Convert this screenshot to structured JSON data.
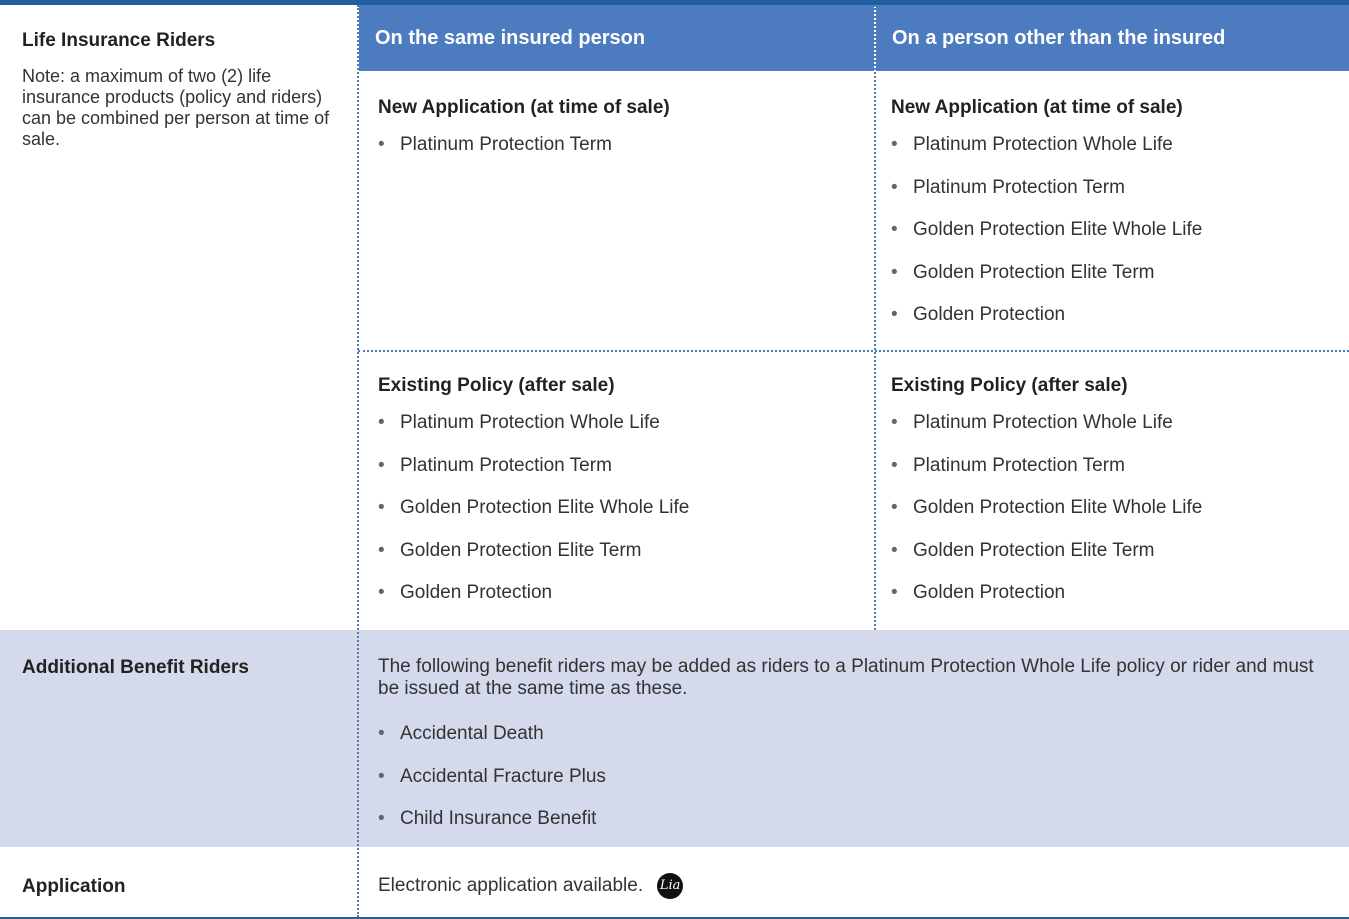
{
  "header": {
    "col_same": "On the same insured person",
    "col_other": "On a person other than the insured"
  },
  "life_riders": {
    "title": "Life Insurance Riders",
    "note": "Note: a maximum of two (2) life insurance products (policy and riders) can be combined per person at time of sale."
  },
  "same_new": {
    "heading": "New Application (at time of sale)",
    "items": [
      "Platinum Protection Term"
    ]
  },
  "other_new": {
    "heading": "New Application (at time of sale)",
    "items": [
      "Platinum Protection Whole Life",
      "Platinum Protection Term",
      "Golden Protection Elite Whole Life",
      "Golden Protection Elite Term",
      "Golden Protection"
    ]
  },
  "same_existing": {
    "heading": "Existing Policy (after sale)",
    "items": [
      "Platinum Protection Whole Life",
      "Platinum Protection Term",
      "Golden Protection Elite Whole Life",
      "Golden Protection Elite Term",
      "Golden Protection"
    ]
  },
  "other_existing": {
    "heading": "Existing Policy (after sale)",
    "items": [
      "Platinum Protection Whole Life",
      "Platinum Protection Term",
      "Golden Protection Elite Whole Life",
      "Golden Protection Elite Term",
      "Golden Protection"
    ]
  },
  "additional": {
    "title": "Additional Benefit Riders",
    "description": "The following benefit riders may be added as riders to a Platinum Protection Whole Life policy or rider and must be issued at the same time as these.",
    "items": [
      "Accidental Death",
      "Accidental Fracture Plus",
      "Child Insurance Benefit"
    ]
  },
  "application": {
    "title": "Application",
    "text": "Electronic application available.",
    "logo_text": "Lia"
  },
  "bullet": "•",
  "colors": {
    "header_bg": "#4d7bc0",
    "top_bar": "#1f5f9e",
    "shaded_row": "#d4d9ec",
    "divider": "#4d7fb6"
  }
}
